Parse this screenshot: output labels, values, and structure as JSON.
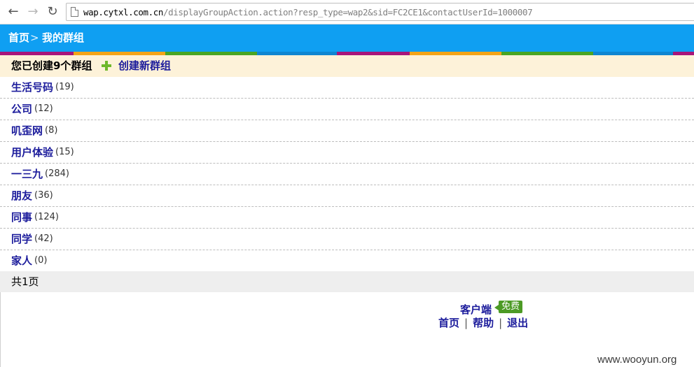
{
  "browser": {
    "url_host": "wap.cytxl.com.cn",
    "url_rest": "/displayGroupAction.action?resp_type=wap2&sid=FC2CE1&contactUserId=1000007"
  },
  "header": {
    "home": "首页",
    "separator": ">",
    "current": "我的群组"
  },
  "colors": {
    "header_bg": "#0f9ff2",
    "link": "#1c1c9c",
    "info_bg": "#fdf2d9",
    "badge_bg": "#4c9a25",
    "stripes": [
      "#a8167a",
      "#f3a417",
      "#4aa524",
      "#0f86d1",
      "#a8167a",
      "#f3a417",
      "#4aa524",
      "#0f86d1",
      "#a8167a"
    ]
  },
  "info": {
    "text": "您已创建9个群组",
    "create_label": "创建新群组"
  },
  "groups": [
    {
      "name": "生活号码",
      "count": "(19)"
    },
    {
      "name": "公司",
      "count": "(12)"
    },
    {
      "name": "叽歪网",
      "count": "(8)"
    },
    {
      "name": "用户体验",
      "count": "(15)"
    },
    {
      "name": "一三九",
      "count": "(284)"
    },
    {
      "name": "朋友",
      "count": "(36)"
    },
    {
      "name": "同事",
      "count": "(124)"
    },
    {
      "name": "同学",
      "count": "(42)"
    },
    {
      "name": "家人",
      "count": "(0)"
    }
  ],
  "pager": "共1页",
  "footer": {
    "client": "客户端",
    "free": "免费",
    "links": [
      "首页",
      "帮助",
      "退出"
    ],
    "separator": "|"
  },
  "watermark": "www.wooyun.org"
}
